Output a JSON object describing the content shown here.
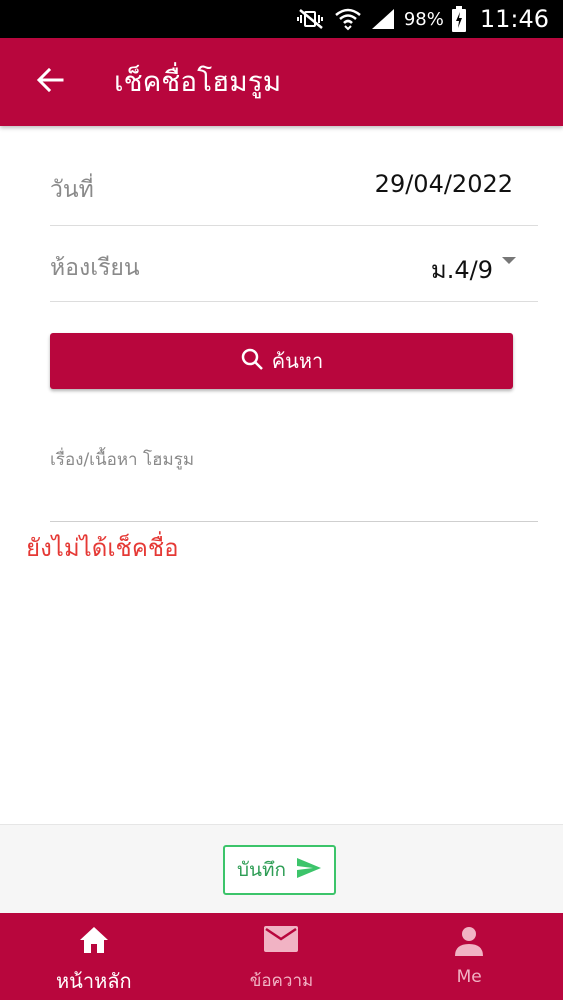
{
  "status_bar": {
    "battery_percent": "98%",
    "time": "11:46",
    "icons": [
      "mute-vibrate-icon",
      "wifi-icon",
      "signal-icon",
      "battery-charging-icon"
    ]
  },
  "app_bar": {
    "title": "เช็คชื่อโฮมรูม",
    "back_icon": "arrow-back-icon"
  },
  "form": {
    "date_label": "วันที่",
    "date_value": "29/04/2022",
    "classroom_label": "ห้องเรียน",
    "classroom_value": "ม.4/9",
    "search_button": "ค้นหา",
    "topic_label": "เรื่อง/เนื้อหา โฮมรูม",
    "status_message": "ยังไม่ได้เช็คชื่อ"
  },
  "footer": {
    "save_button": "บันทึก"
  },
  "bottom_nav": {
    "items": [
      {
        "label": "หน้าหลัก",
        "icon": "home-icon",
        "active": true
      },
      {
        "label": "ข้อความ",
        "icon": "mail-icon",
        "active": false
      },
      {
        "label": "Me",
        "icon": "person-icon",
        "active": false
      }
    ]
  },
  "colors": {
    "primary": "#b8063d",
    "error_text": "#e53935",
    "save_green": "#3cc46a"
  }
}
